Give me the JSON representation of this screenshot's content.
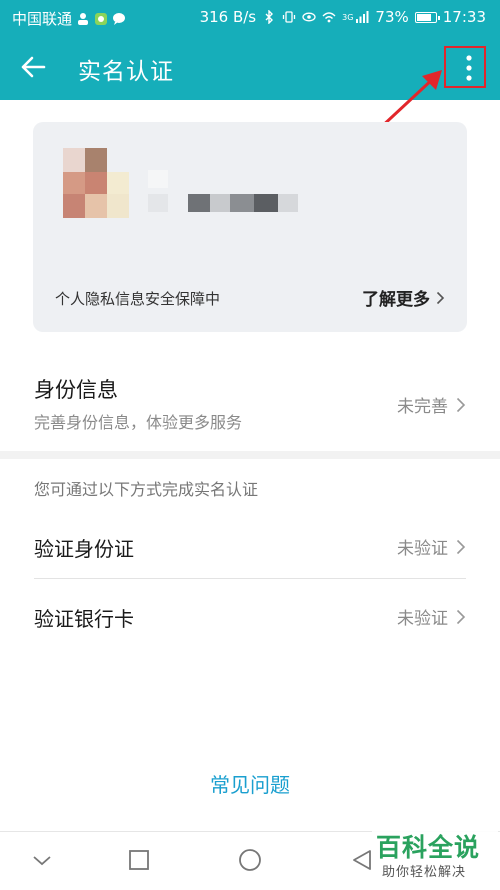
{
  "status_bar": {
    "carrier": "中国联通",
    "speed": "316 B/s",
    "network": "3G",
    "battery": "73%",
    "time": "17:33"
  },
  "app_bar": {
    "title": "实名认证",
    "back_icon": "arrow-left-icon",
    "more_icon": "more-vertical-icon"
  },
  "profile_card": {
    "privacy_text": "个人隐私信息安全保障中",
    "learn_more": "了解更多"
  },
  "identity_info": {
    "title": "身份信息",
    "subtitle": "完善身份信息，体验更多服务",
    "status": "未完善"
  },
  "methods_hint": "您可通过以下方式完成实名认证",
  "methods": [
    {
      "label": "验证身份证",
      "status": "未验证"
    },
    {
      "label": "验证银行卡",
      "status": "未验证"
    }
  ],
  "faq_link": "常见问题",
  "nav_icons": [
    "chevron-down-icon",
    "square-icon",
    "circle-icon",
    "triangle-back-icon"
  ],
  "watermark": {
    "title": "百科全说",
    "subtitle": "助你轻松解决"
  },
  "colors": {
    "header": "#16aeba",
    "link": "#1a9fcf",
    "annotation": "#e2262b",
    "watermark": "#2aa25e"
  }
}
